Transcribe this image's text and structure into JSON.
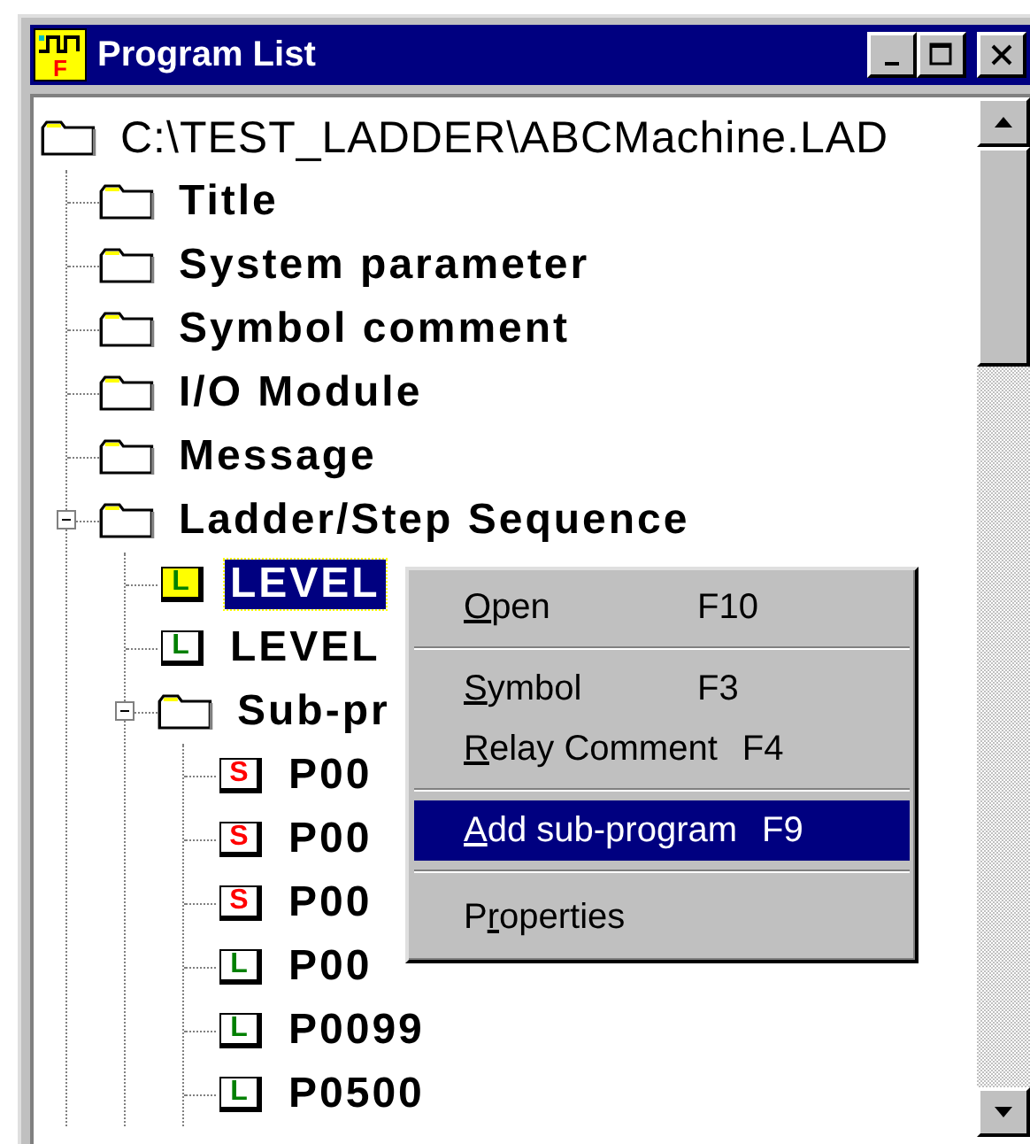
{
  "window": {
    "title": "Program List",
    "icon_letter": "F"
  },
  "tree": {
    "label": "C:\\TEST_LADDER\\ABCMachine.LAD",
    "kind": "folder",
    "selected": false,
    "children": [
      {
        "label": "Title",
        "kind": "folder",
        "selected": false
      },
      {
        "label": "System parameter",
        "kind": "folder",
        "selected": false
      },
      {
        "label": "Symbol comment",
        "kind": "folder",
        "selected": false
      },
      {
        "label": "I/O Module",
        "kind": "folder",
        "selected": false
      },
      {
        "label": "Message",
        "kind": "folder",
        "selected": false
      },
      {
        "label": "Ladder/Step Sequence",
        "kind": "folder",
        "selected": false,
        "expanded": true,
        "children": [
          {
            "label": "LEVEL",
            "kind": "ladder",
            "badge": "L",
            "selected": true
          },
          {
            "label": "LEVEL",
            "kind": "ladder",
            "badge": "L",
            "selected": false
          },
          {
            "label": "Sub-pr",
            "kind": "folder",
            "selected": false,
            "expanded": true,
            "children": [
              {
                "label": "P00",
                "kind": "step",
                "badge": "S",
                "selected": false
              },
              {
                "label": "P00",
                "kind": "step",
                "badge": "S",
                "selected": false
              },
              {
                "label": "P00",
                "kind": "step",
                "badge": "S",
                "selected": false
              },
              {
                "label": "P00",
                "kind": "ladder",
                "badge": "L",
                "selected": false
              },
              {
                "label": "P0099",
                "kind": "ladder",
                "badge": "L",
                "selected": false
              },
              {
                "label": "P0500",
                "kind": "ladder",
                "badge": "L",
                "selected": false
              }
            ]
          }
        ]
      }
    ]
  },
  "context_menu": [
    {
      "kind": "command",
      "label": [
        {
          "text": "O",
          "underlined": true
        },
        {
          "text": "pen",
          "underlined": false
        }
      ],
      "shortcut": "F10",
      "selected": false
    },
    {
      "kind": "separator"
    },
    {
      "kind": "command",
      "label": [
        {
          "text": "S",
          "underlined": true
        },
        {
          "text": "ymbol",
          "underlined": false
        }
      ],
      "shortcut": "F3",
      "selected": false
    },
    {
      "kind": "command",
      "label": [
        {
          "text": "R",
          "underlined": true
        },
        {
          "text": "elay Comment",
          "underlined": false
        }
      ],
      "shortcut": "F4",
      "selected": false
    },
    {
      "kind": "separator"
    },
    {
      "kind": "command",
      "label": [
        {
          "text": "A",
          "underlined": true
        },
        {
          "text": "dd sub-program",
          "underlined": false
        }
      ],
      "shortcut": "F9",
      "selected": true
    },
    {
      "kind": "separator"
    },
    {
      "kind": "command",
      "label": [
        {
          "text": "P",
          "underlined": false
        },
        {
          "text": "r",
          "underlined": true
        },
        {
          "text": "operties",
          "underlined": false
        }
      ],
      "selected": false
    }
  ]
}
